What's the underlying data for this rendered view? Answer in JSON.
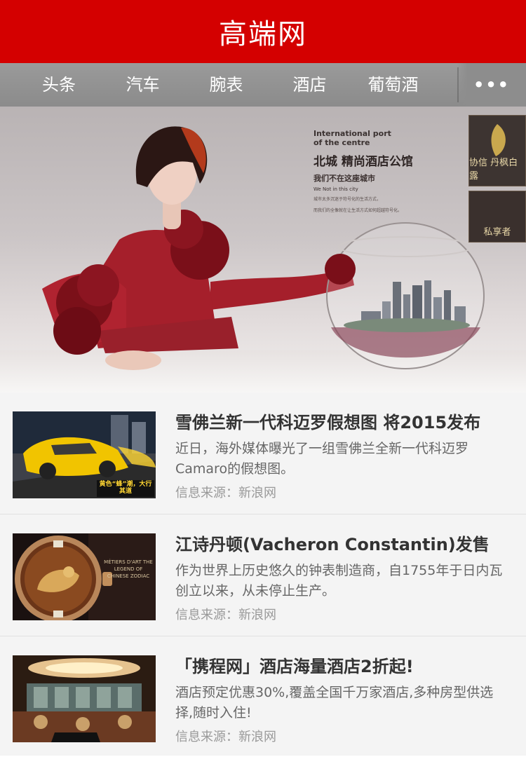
{
  "header": {
    "title": "高端网"
  },
  "tabs": [
    {
      "label": "头条"
    },
    {
      "label": "汽车"
    },
    {
      "label": "腕表"
    },
    {
      "label": "酒店"
    },
    {
      "label": "葡萄酒"
    }
  ],
  "more_label": "•••",
  "banner": {
    "en_line1": "International port",
    "en_line2": "of the centre",
    "cn_title": "北城 精尚酒店公馆",
    "cn_sub": "我们不在这座城市",
    "en_sub": "We Not in this city",
    "small_line1": "城市太多沉迷于符号化的生活方式，",
    "small_line2": "而我们的全像就在让生活方式如何超越符号化。",
    "card1_text": "协信 丹枫白露",
    "card2_text": "私享者"
  },
  "news": [
    {
      "title": "雪佛兰新一代科迈罗假想图 将2015发布",
      "desc": "近日，海外媒体曝光了一组雪佛兰全新一代科迈罗Camaro的假想图。",
      "source": "信息来源：新浪网",
      "image_caption": "黄色“蜂”潮，大行其道"
    },
    {
      "title": "江诗丹顿(Vacheron Constantin)发售",
      "desc": "作为世界上历史悠久的钟表制造商，自1755年于日内瓦创立以来，从未停止生产。",
      "source": "信息来源：新浪网",
      "image_caption": "MÉTIERS D'ART THE LEGEND OF CHINESE ZODIAC"
    },
    {
      "title": "「携程网」酒店海量酒店2折起!",
      "desc": "酒店预定优惠30%,覆盖全国千万家酒店,多种房型供选择,随时入住!",
      "source": "信息来源：新浪网"
    }
  ],
  "colors": {
    "brand": "#d40000",
    "tabbar": "#8f8f8f"
  }
}
